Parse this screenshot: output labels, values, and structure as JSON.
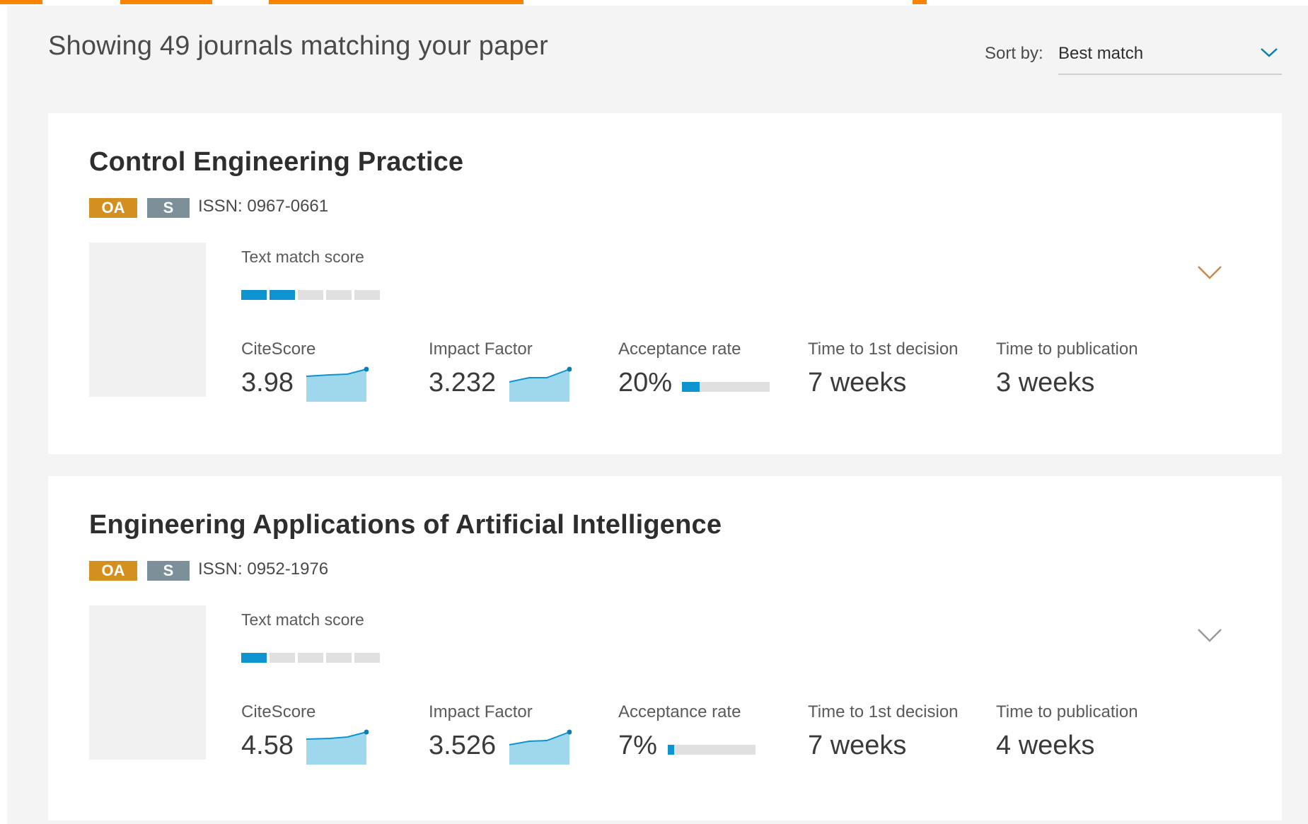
{
  "results": {
    "title": "Showing 49 journals matching your paper"
  },
  "sort": {
    "label": "Sort by:",
    "value": "Best match"
  },
  "colors": {
    "accent_orange": "#ff8200",
    "oa_badge": "#d4901e",
    "s_badge": "#7d8f99",
    "bar_blue": "#0b94cf",
    "spark_fill": "#9fd8ec"
  },
  "metric_labels": {
    "text_match": "Text match score",
    "citescore": "CiteScore",
    "impact": "Impact Factor",
    "acceptance": "Acceptance rate",
    "first_decision": "Time to 1st decision",
    "publication": "Time to publication"
  },
  "journals": [
    {
      "name": "Control Engineering Practice",
      "badges": [
        "OA",
        "S"
      ],
      "issn": "ISSN: 0967-0661",
      "text_match_score": 2,
      "text_match_max": 5,
      "citescore": "3.98",
      "impact_factor": "3.232",
      "acceptance_rate": "20%",
      "acceptance_fraction": 0.2,
      "time_to_first_decision": "7 weeks",
      "time_to_publication": "3 weeks",
      "expanded_hint_color": "#c98a4a"
    },
    {
      "name": "Engineering Applications of Artificial Intelligence",
      "badges": [
        "OA",
        "S"
      ],
      "issn": "ISSN: 0952-1976",
      "text_match_score": 1,
      "text_match_max": 5,
      "citescore": "4.58",
      "impact_factor": "3.526",
      "acceptance_rate": "7%",
      "acceptance_fraction": 0.07,
      "time_to_first_decision": "7 weeks",
      "time_to_publication": "4 weeks",
      "expanded_hint_color": "#9a9a9a"
    }
  ],
  "icons": {
    "sort": "chevron-down-icon",
    "expand": "chevron-down-icon"
  }
}
